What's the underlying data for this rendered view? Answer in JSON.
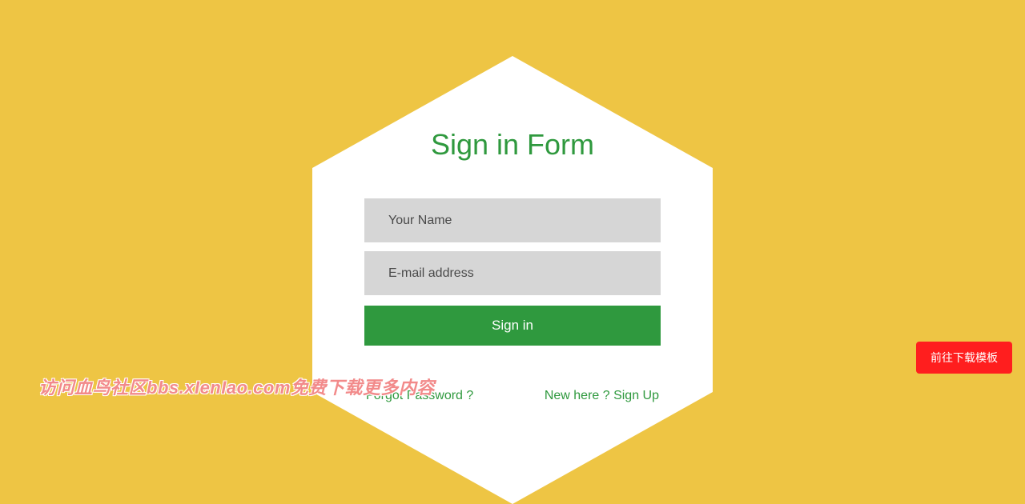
{
  "form": {
    "title": "Sign in Form",
    "name_placeholder": "Your Name",
    "email_placeholder": "E-mail address",
    "submit_label": "Sign in",
    "forgot_link": "Forgot Password ?",
    "signup_link": "New here ? Sign Up"
  },
  "red_button": {
    "label": "前往下载模板"
  },
  "watermark": {
    "text": "访问血鸟社区bbs.xIenIao.com免费下载更多内容"
  },
  "colors": {
    "background": "#eec544",
    "accent": "#2f993e",
    "input_bg": "#d6d6d6",
    "red_button": "#ff1e1e"
  }
}
